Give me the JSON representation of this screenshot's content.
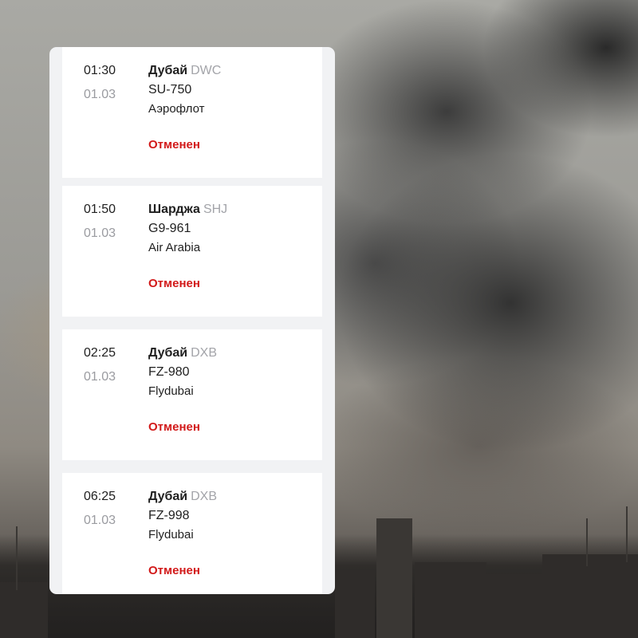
{
  "flights": [
    {
      "time": "01:30",
      "date": "01.03",
      "city": "Дубай",
      "code": "DWC",
      "flight": "SU-750",
      "airline": "Аэрофлот",
      "status": "Отменен"
    },
    {
      "time": "01:50",
      "date": "01.03",
      "city": "Шарджа",
      "code": "SHJ",
      "flight": "G9-961",
      "airline": "Air Arabia",
      "status": "Отменен"
    },
    {
      "time": "02:25",
      "date": "01.03",
      "city": "Дубай",
      "code": "DXB",
      "flight": "FZ-980",
      "airline": "Flydubai",
      "status": "Отменен"
    },
    {
      "time": "06:25",
      "date": "01.03",
      "city": "Дубай",
      "code": "DXB",
      "flight": "FZ-998",
      "airline": "Flydubai",
      "status": "Отменен"
    }
  ],
  "colors": {
    "status_cancelled": "#d21a1a",
    "muted_text": "#9a9ba0",
    "card_background": "#ffffff",
    "panel_background": "#f1f2f4"
  }
}
